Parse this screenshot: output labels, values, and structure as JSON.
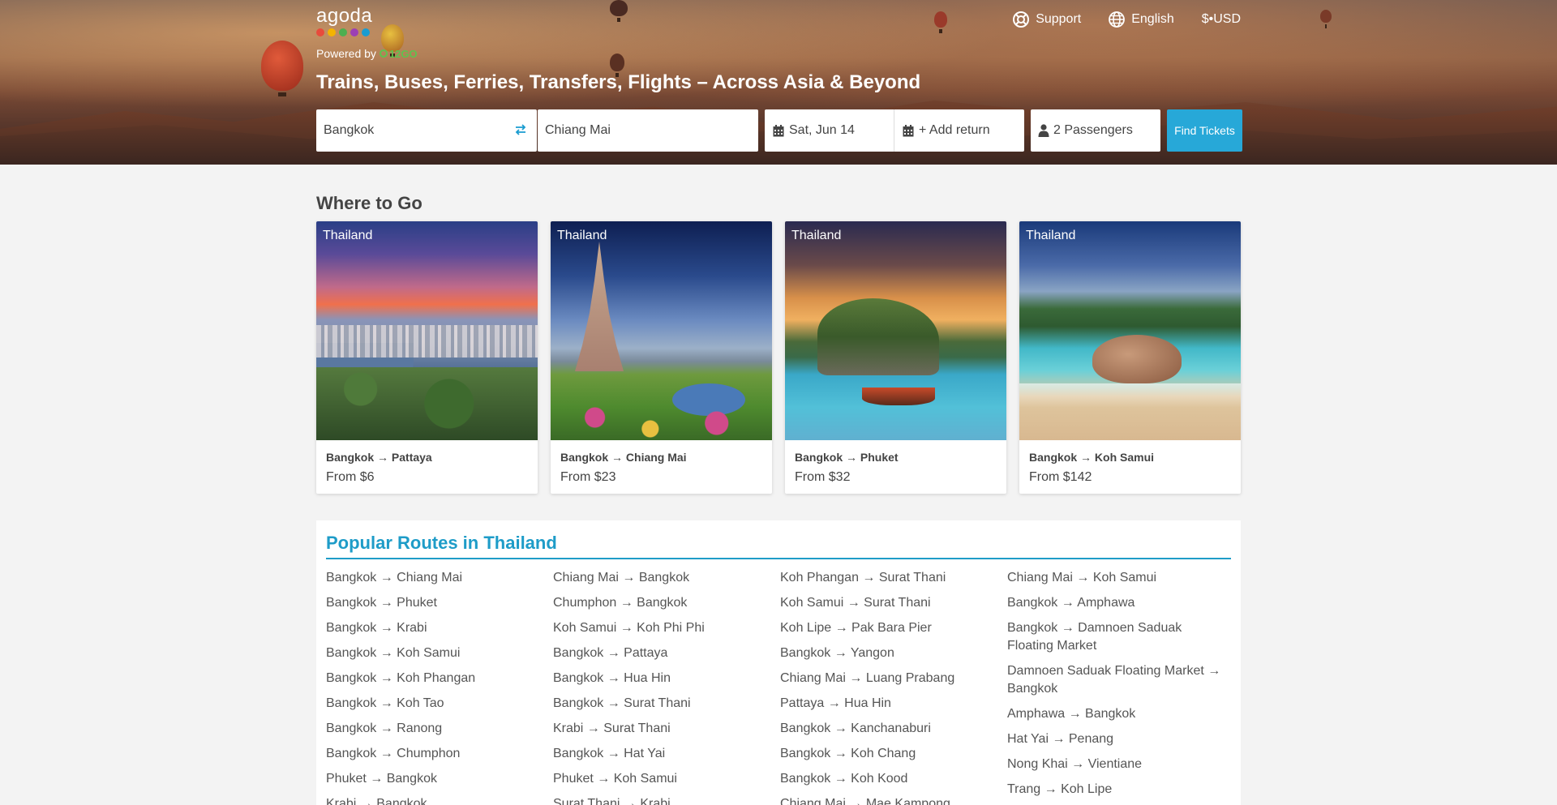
{
  "header": {
    "logo_text": "agoda",
    "logo_dot_colors": [
      "#e84b3c",
      "#f4b400",
      "#4caf50",
      "#9c3fb5",
      "#1a9cd0"
    ],
    "powered_by": "Powered by",
    "powered_brand": "12GO",
    "nav": [
      {
        "label": "Support",
        "icon": "lifebuoy-icon"
      },
      {
        "label": "English",
        "icon": "globe-icon"
      },
      {
        "label": "$•USD",
        "icon": ""
      }
    ],
    "headline": "Trains, Buses, Ferries, Transfers, Flights – Across Asia & Beyond"
  },
  "search": {
    "from": "Bangkok",
    "to": "Chiang Mai",
    "date": "Sat, Jun 14",
    "return": "+ Add return",
    "passengers": "2 Passengers",
    "button": "Find Tickets",
    "accent": "#27a8d8"
  },
  "where_to_go": {
    "title": "Where to Go",
    "cards": [
      {
        "country": "Thailand",
        "route": "Bangkok → Pattaya",
        "price": "From $6"
      },
      {
        "country": "Thailand",
        "route": "Bangkok → Chiang Mai",
        "price": "From $23"
      },
      {
        "country": "Thailand",
        "route": "Bangkok → Phuket",
        "price": "From $32"
      },
      {
        "country": "Thailand",
        "route": "Bangkok → Koh Samui",
        "price": "From $142"
      }
    ]
  },
  "popular": {
    "title": "Popular Routes in Thailand",
    "columns": [
      [
        "Bangkok → Chiang Mai",
        "Bangkok → Phuket",
        "Bangkok → Krabi",
        "Bangkok → Koh Samui",
        "Bangkok → Koh Phangan",
        "Bangkok → Koh Tao",
        "Bangkok → Ranong",
        "Bangkok → Chumphon",
        "Phuket → Bangkok",
        "Krabi → Bangkok"
      ],
      [
        "Chiang Mai → Bangkok",
        "Chumphon → Bangkok",
        "Koh Samui → Koh Phi Phi",
        "Bangkok → Pattaya",
        "Bangkok → Hua Hin",
        "Bangkok → Surat Thani",
        "Krabi → Surat Thani",
        "Bangkok → Hat Yai",
        "Phuket → Koh Samui",
        "Surat Thani → Krabi"
      ],
      [
        "Koh Phangan → Surat Thani",
        "Koh Samui → Surat Thani",
        "Koh Lipe → Pak Bara Pier",
        "Bangkok → Yangon",
        "Chiang Mai → Luang Prabang",
        "Pattaya → Hua Hin",
        "Bangkok → Kanchanaburi",
        "Bangkok → Koh Chang",
        "Bangkok → Koh Kood",
        "Chiang Mai → Mae Kampong"
      ],
      [
        "Chiang Mai → Koh Samui",
        "Bangkok → Amphawa",
        "Bangkok → Damnoen Saduak Floating Market",
        "Damnoen Saduak Floating Market → Bangkok",
        "Amphawa → Bangkok",
        "Hat Yai → Penang",
        "Nong Khai → Vientiane",
        "Trang → Koh Lipe"
      ]
    ]
  }
}
